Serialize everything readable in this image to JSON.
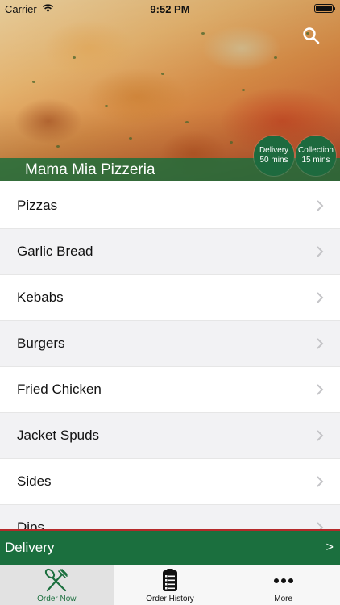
{
  "status_bar": {
    "carrier": "Carrier",
    "time": "9:52 PM"
  },
  "header": {
    "restaurant_name": "Mama Mia Pizzeria",
    "delivery_badge": {
      "line1": "Delivery",
      "line2": "50 mins"
    },
    "collection_badge": {
      "line1": "Collection",
      "line2": "15 mins"
    },
    "search_icon": "search-icon"
  },
  "categories": [
    {
      "label": "Pizzas"
    },
    {
      "label": "Garlic Bread"
    },
    {
      "label": "Kebabs"
    },
    {
      "label": "Burgers"
    },
    {
      "label": "Fried Chicken"
    },
    {
      "label": "Jacket Spuds"
    },
    {
      "label": "Sides"
    },
    {
      "label": "Dips"
    }
  ],
  "delivery_bar": {
    "label": "Delivery",
    "arrow": ">"
  },
  "tabs": [
    {
      "label": "Order Now",
      "icon": "fork-knife-icon",
      "active": true
    },
    {
      "label": "Order History",
      "icon": "clipboard-icon",
      "active": false
    },
    {
      "label": "More",
      "icon": "more-dots-icon",
      "active": false
    }
  ],
  "colors": {
    "brand_green": "#1b6f3e",
    "accent_red": "#b52a2a"
  }
}
